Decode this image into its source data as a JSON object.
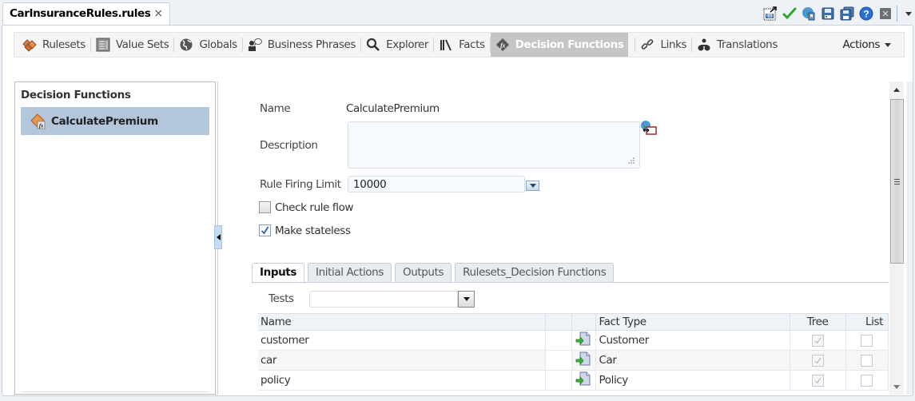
{
  "document_tab": {
    "title": "CarInsuranceRules.rules",
    "close_label": "×"
  },
  "window_toolbar": {
    "icons": [
      "generate-report-icon",
      "validate-check-icon",
      "translation-globe-icon",
      "save-icon",
      "save-all-icon",
      "help-icon",
      "close-editor-icon",
      "overflow-menu-icon"
    ]
  },
  "nav_toolbar": {
    "items": [
      {
        "label": "Rulesets",
        "icon": "rulesets-icon",
        "active": false
      },
      {
        "label": "Value Sets",
        "icon": "value-sets-icon",
        "active": false
      },
      {
        "label": "Globals",
        "icon": "globe-icon",
        "active": false
      },
      {
        "label": "Business Phrases",
        "icon": "business-phrases-icon",
        "active": false
      },
      {
        "label": "Explorer",
        "icon": "search-icon",
        "active": false
      },
      {
        "label": "Facts",
        "icon": "facts-icon",
        "active": false
      },
      {
        "label": "Decision Functions",
        "icon": "decision-function-icon",
        "active": true
      },
      {
        "label": "Links",
        "icon": "link-icon",
        "active": false
      },
      {
        "label": "Translations",
        "icon": "translations-icon",
        "active": false
      }
    ],
    "actions_label": "Actions"
  },
  "left_panel": {
    "title": "Decision Functions",
    "items": [
      {
        "label": "CalculatePremium",
        "selected": true
      }
    ]
  },
  "form": {
    "name_label": "Name",
    "name_value": "CalculatePremium",
    "description_label": "Description",
    "description_value": "",
    "rule_firing_limit_label": "Rule Firing Limit",
    "rule_firing_limit_value": "10000",
    "check_rule_flow_label": "Check rule flow",
    "check_rule_flow_checked": false,
    "make_stateless_label": "Make stateless",
    "make_stateless_checked": true
  },
  "tabs": [
    {
      "label": "Inputs",
      "active": true
    },
    {
      "label": "Initial Actions",
      "active": false
    },
    {
      "label": "Outputs",
      "active": false
    },
    {
      "label": "Rulesets_Decision Functions",
      "active": false
    }
  ],
  "tests": {
    "label": "Tests",
    "value": ""
  },
  "inputs_table": {
    "columns": [
      "Name",
      "",
      "",
      "Fact Type",
      "Tree",
      "List"
    ],
    "rows": [
      {
        "name": "customer",
        "fact_type": "Customer",
        "tree": true,
        "list": false
      },
      {
        "name": "car",
        "fact_type": "Car",
        "tree": true,
        "list": false
      },
      {
        "name": "policy",
        "fact_type": "Policy",
        "tree": true,
        "list": false
      }
    ]
  },
  "colors": {
    "accent_selected": "#b4c6dc",
    "active_tab_bg": "#c5c5c5",
    "check_green": "#2fa52f"
  }
}
